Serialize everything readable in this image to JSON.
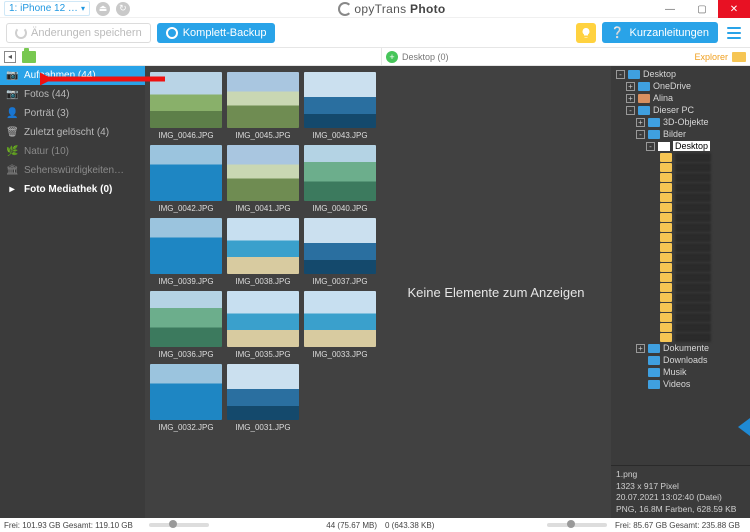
{
  "titlebar": {
    "device_label": "1: iPhone 12 …",
    "brand_thin": "opyTrans",
    "brand_bold": "Photo"
  },
  "toolbar": {
    "save_label": "Änderungen speichern",
    "backup_label": "Komplett-Backup",
    "guide_label": "Kurzanleitungen"
  },
  "strip": {
    "desktop_chip": "Desktop (0)",
    "explorer_label": "Explorer"
  },
  "sidebar": {
    "items": [
      {
        "icon": "📷",
        "label": "Aufnahmen (44)",
        "active": true
      },
      {
        "icon": "📷",
        "label": "Fotos (44)"
      },
      {
        "icon": "👤",
        "label": "Porträt (3)"
      },
      {
        "icon": "🗑",
        "label": "Zuletzt gelöscht (4)"
      },
      {
        "icon": "🌿",
        "label": "Natur (10)",
        "dim": true
      },
      {
        "icon": "🏛",
        "label": "Sehenswürdigkeiten…",
        "dim": true
      },
      {
        "icon": "▸",
        "label": "Foto Mediathek (0)",
        "bold": true
      }
    ]
  },
  "status_left": "Frei: 101.93 GB Gesamt: 119.10 GB",
  "thumbs": [
    {
      "name": "IMG_0046.JPG",
      "cls": "lg-a"
    },
    {
      "name": "IMG_0045.JPG",
      "cls": "lg-b"
    },
    {
      "name": "IMG_0043.JPG",
      "cls": "lg-c"
    },
    {
      "name": "IMG_0042.JPG",
      "cls": "lg-d"
    },
    {
      "name": "IMG_0041.JPG",
      "cls": "lg-b"
    },
    {
      "name": "IMG_0040.JPG",
      "cls": "lg-f"
    },
    {
      "name": "IMG_0039.JPG",
      "cls": "lg-d"
    },
    {
      "name": "IMG_0038.JPG",
      "cls": "lg-e"
    },
    {
      "name": "IMG_0037.JPG",
      "cls": "lg-c"
    },
    {
      "name": "IMG_0036.JPG",
      "cls": "lg-f"
    },
    {
      "name": "IMG_0035.JPG",
      "cls": "lg-e"
    },
    {
      "name": "IMG_0033.JPG",
      "cls": "lg-e"
    },
    {
      "name": "IMG_0032.JPG",
      "cls": "lg-d"
    },
    {
      "name": "IMG_0031.JPG",
      "cls": "lg-c"
    }
  ],
  "thumbs_status": "44 (75.67 MB)",
  "drop_text": "Keine Elemente zum Anzeigen",
  "drop_status": "0 (643.38 KB)",
  "tree": {
    "roots": [
      {
        "exp": "-",
        "icon": "desktop",
        "label": "Desktop",
        "indent": 0
      },
      {
        "exp": "+",
        "icon": "folder-blue",
        "label": "OneDrive",
        "indent": 1
      },
      {
        "exp": "+",
        "icon": "user",
        "label": "Alina",
        "indent": 1
      },
      {
        "exp": "-",
        "icon": "pc",
        "label": "Dieser PC",
        "indent": 1
      },
      {
        "exp": "+",
        "icon": "folder-blue",
        "label": "3D-Objekte",
        "indent": 2
      },
      {
        "exp": "-",
        "icon": "folder-blue",
        "label": "Bilder",
        "indent": 2
      },
      {
        "exp": "-",
        "icon": "sel",
        "label": "Desktop",
        "indent": 3,
        "selected": true
      }
    ],
    "subfolder_count": 19,
    "after": [
      {
        "exp": "+",
        "icon": "folder-blue",
        "label": "Dokumente",
        "indent": 2
      },
      {
        "exp": "",
        "icon": "folder-blue",
        "label": "Downloads",
        "indent": 2
      },
      {
        "exp": "",
        "icon": "folder-blue",
        "label": "Musik",
        "indent": 2
      },
      {
        "exp": "",
        "icon": "folder-blue",
        "label": "Videos",
        "indent": 2
      }
    ]
  },
  "fileinfo": {
    "name": "1.png",
    "dims": "1323 x 917 Pixel",
    "date": "20.07.2021 13:02:40  (Datei)",
    "meta": "PNG, 16.8M Farben, 628.59 KB"
  },
  "status_right": "Frei: 85.67 GB Gesamt: 235.88 GB"
}
